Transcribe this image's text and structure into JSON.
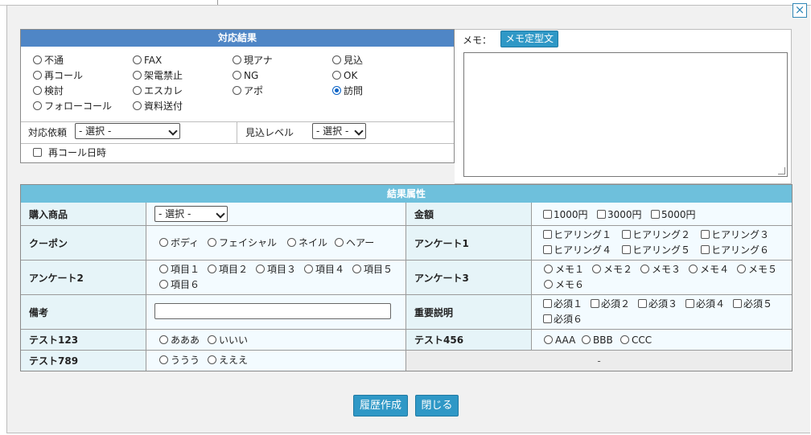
{
  "dialog": {
    "close_icon": "×"
  },
  "result": {
    "title": "対応結果",
    "options": [
      {
        "label": "不通",
        "checked": false
      },
      {
        "label": "FAX",
        "checked": false
      },
      {
        "label": "現アナ",
        "checked": false
      },
      {
        "label": "見込",
        "checked": false
      },
      {
        "label": "再コール",
        "checked": false
      },
      {
        "label": "架電禁止",
        "checked": false
      },
      {
        "label": "NG",
        "checked": false
      },
      {
        "label": "OK",
        "checked": false
      },
      {
        "label": "検討",
        "checked": false
      },
      {
        "label": "エスカレ",
        "checked": false
      },
      {
        "label": "アポ",
        "checked": false
      },
      {
        "label": "訪問",
        "checked": true
      },
      {
        "label": "フォローコール",
        "checked": false
      },
      {
        "label": "資料送付",
        "checked": false
      }
    ],
    "request_label": "対応依頼",
    "request_select": "- 選択 -",
    "prospect_label": "見込レベル",
    "prospect_select": "- 選択 -",
    "recall_label": "再コール日時"
  },
  "memo": {
    "label": "メモ：",
    "template_button": "メモ定型文",
    "value": ""
  },
  "attributes": {
    "title": "結果属性",
    "purchase_label": "購入商品",
    "purchase_select": "- 選択 -",
    "amount_label": "金額",
    "amount_options": [
      "1000円",
      "3000円",
      "5000円"
    ],
    "coupon_label": "クーポン",
    "coupon_options": [
      "ボディ",
      "フェイシャル",
      "ネイル",
      "ヘアー"
    ],
    "survey1_label": "アンケート1",
    "survey1_options": [
      "ヒアリング１",
      "ヒアリング２",
      "ヒアリング３",
      "ヒアリング４",
      "ヒアリング５",
      "ヒアリング６"
    ],
    "survey2_label": "アンケート2",
    "survey2_options": [
      "項目１",
      "項目２",
      "項目３",
      "項目４",
      "項目５",
      "項目６"
    ],
    "survey3_label": "アンケート3",
    "survey3_options": [
      "メモ１",
      "メモ２",
      "メモ３",
      "メモ４",
      "メモ５",
      "メモ６"
    ],
    "notes_label": "備考",
    "notes_value": "",
    "important_label": "重要説明",
    "important_options": [
      "必須１",
      "必須２",
      "必須３",
      "必須４",
      "必須５",
      "必須６"
    ],
    "test123_label": "テスト123",
    "test123_options": [
      "あああ",
      "いいい"
    ],
    "test456_label": "テスト456",
    "test456_options": [
      "AAA",
      "BBB",
      "CCC"
    ],
    "test789_label": "テスト789",
    "test789_options": [
      "ううう",
      "えええ"
    ],
    "empty_cell": "-"
  },
  "footer": {
    "create_history": "履歴作成",
    "close": "閉じる"
  }
}
